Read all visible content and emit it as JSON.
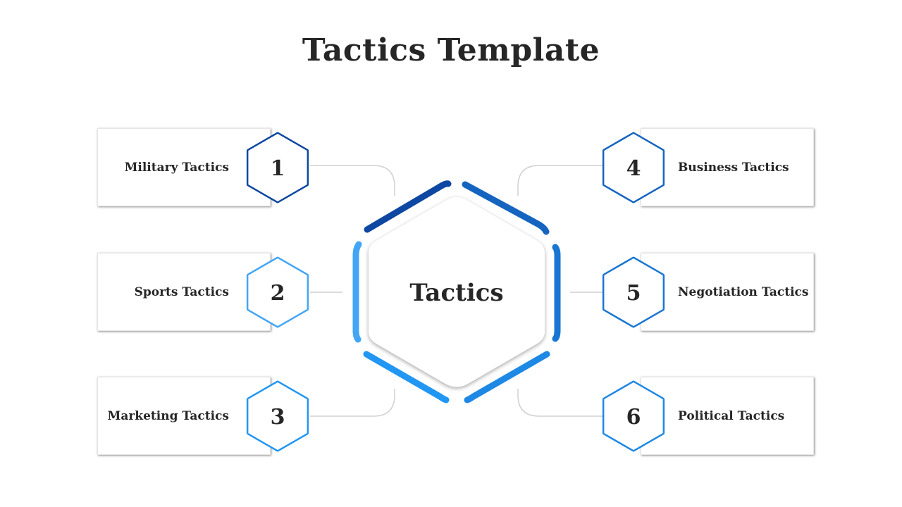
{
  "title": "Tactics Template",
  "center": {
    "label": "Tactics"
  },
  "items": [
    {
      "number": "1",
      "label": "Military Tactics",
      "color": "#0d47a1"
    },
    {
      "number": "2",
      "label": "Sports Tactics",
      "color": "#42a5f5"
    },
    {
      "number": "3",
      "label": "Marketing Tactics",
      "color": "#2196f3"
    },
    {
      "number": "4",
      "label": "Business Tactics",
      "color": "#1565c0"
    },
    {
      "number": "5",
      "label": "Negotiation Tactics",
      "color": "#1976d2"
    },
    {
      "number": "6",
      "label": "Political Tactics",
      "color": "#1e88e5"
    }
  ],
  "ring_segments": [
    {
      "position": "top-left",
      "color": "#0d47a1"
    },
    {
      "position": "top-right",
      "color": "#1565c0"
    },
    {
      "position": "right",
      "color": "#1976d2"
    },
    {
      "position": "bottom-right",
      "color": "#1e88e5"
    },
    {
      "position": "bottom-left",
      "color": "#2196f3"
    },
    {
      "position": "left",
      "color": "#42a5f5"
    }
  ]
}
